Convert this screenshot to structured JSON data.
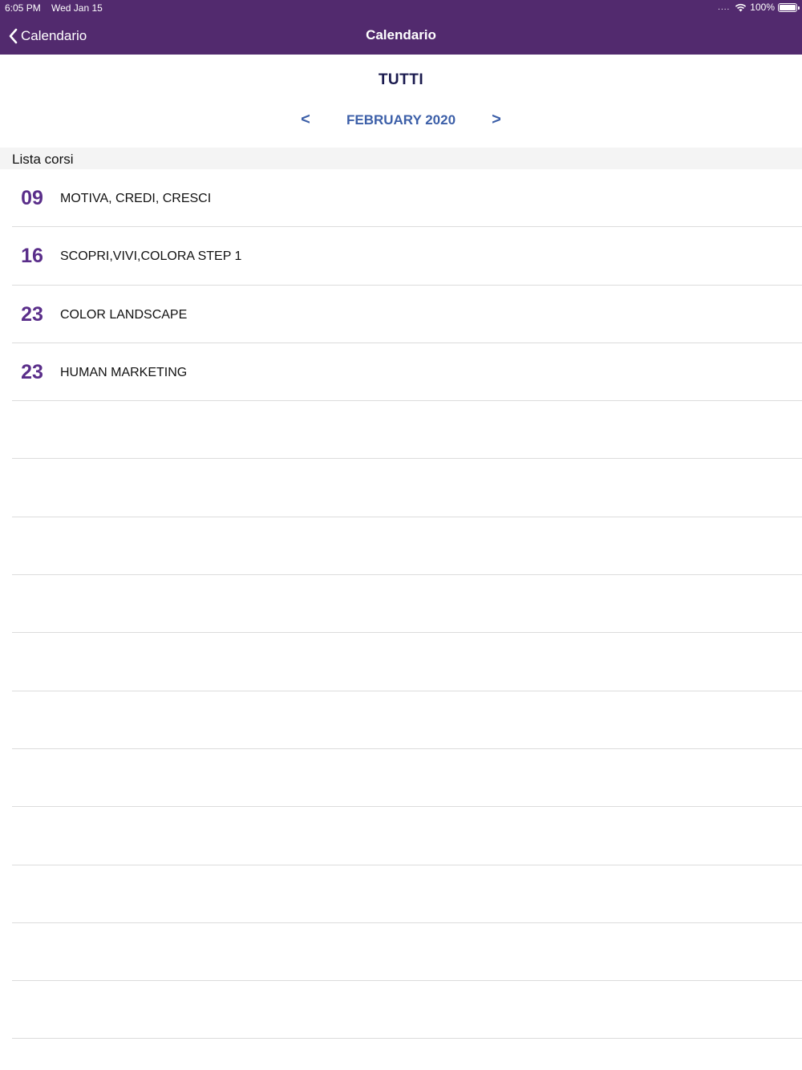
{
  "status_bar": {
    "time": "6:05 PM",
    "date": "Wed Jan 15",
    "signal_dots": "....",
    "battery": "100%",
    "wifi_icon": "wifi-icon",
    "battery_icon": "battery-icon"
  },
  "nav": {
    "back_label": "Calendario",
    "title": "Calendario",
    "back_icon": "chevron-left-icon"
  },
  "filter": {
    "title": "TUTTI"
  },
  "month_nav": {
    "prev_label": "<",
    "month": "FEBRUARY 2020",
    "next_label": ">"
  },
  "section": {
    "header": "Lista corsi"
  },
  "courses": [
    {
      "day": "09",
      "title": "MOTIVA, CREDI, CRESCI"
    },
    {
      "day": "16",
      "title": "SCOPRI,VIVI,COLORA STEP 1"
    },
    {
      "day": "23",
      "title": "COLOR LANDSCAPE"
    },
    {
      "day": "23",
      "title": "HUMAN MARKETING"
    }
  ],
  "colors": {
    "header_bg": "#522a6e",
    "day_number": "#5a2e8a",
    "month_nav": "#3c5fa8",
    "filter_title": "#1a1a4e",
    "section_bg": "#f4f4f4"
  }
}
